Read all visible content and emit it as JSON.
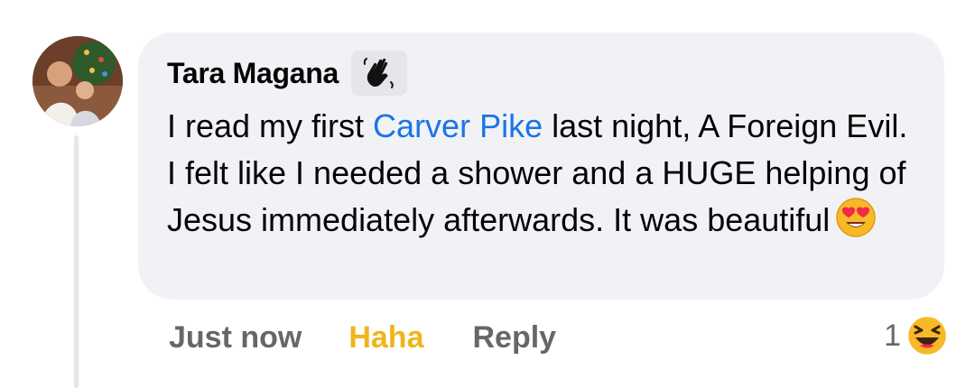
{
  "comment": {
    "author": "Tara Magana",
    "badge_icon": "waving-hand-icon",
    "text_before": "I read my first ",
    "mention": "Carver Pike",
    "text_after": " last night, A Foreign Evil. I felt like I needed a shower and a HUGE helping of Jesus immediately afterwards. It was beautiful",
    "inline_emoji": "heart-eyes-emoji-icon"
  },
  "actions": {
    "time": "Just now",
    "reaction": "Haha",
    "reply": "Reply"
  },
  "reactions": {
    "count": "1",
    "icon": "haha-reaction-icon"
  },
  "colors": {
    "bubble": "#f0f2f5",
    "mention": "#1b74e4",
    "haha": "#f1b41c",
    "secondary": "#65676b"
  }
}
